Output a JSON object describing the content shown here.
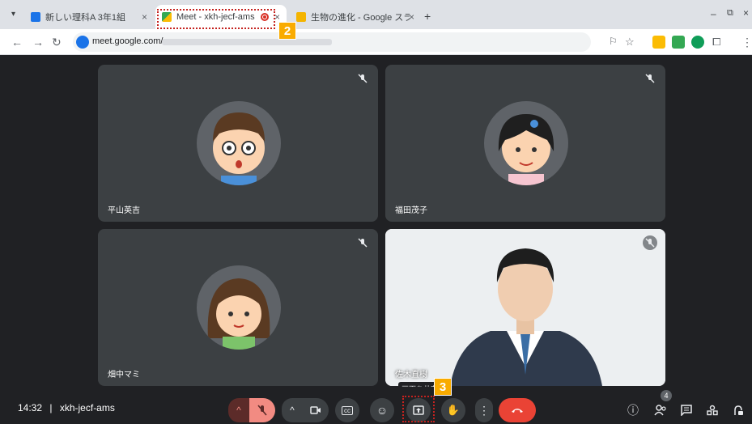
{
  "browser": {
    "tabs": [
      {
        "title": "新しい理科A 3年1組",
        "favicon": "classroom-icon"
      },
      {
        "title": "Meet - xkh-jecf-ams",
        "favicon": "meet-icon"
      },
      {
        "title": "生物の進化 - Google スライド",
        "favicon": "slides-icon"
      }
    ],
    "url": "meet.google.com/"
  },
  "participants": [
    {
      "name": "平山英吉",
      "muted": true
    },
    {
      "name": "福田茂子",
      "muted": true
    },
    {
      "name": "畑中マミ",
      "muted": true
    },
    {
      "name": "佐木直樹",
      "muted": true
    }
  ],
  "meeting": {
    "time": "14:32",
    "separator": "|",
    "code": "xkh-jecf-ams",
    "participant_count": "4"
  },
  "tooltip": "画面を共有",
  "annotations": {
    "step2": "2",
    "step3": "3"
  },
  "colors": {
    "end_call": "#ea4335",
    "mic_off": "#f28b82",
    "badge": "#f9ab00"
  }
}
